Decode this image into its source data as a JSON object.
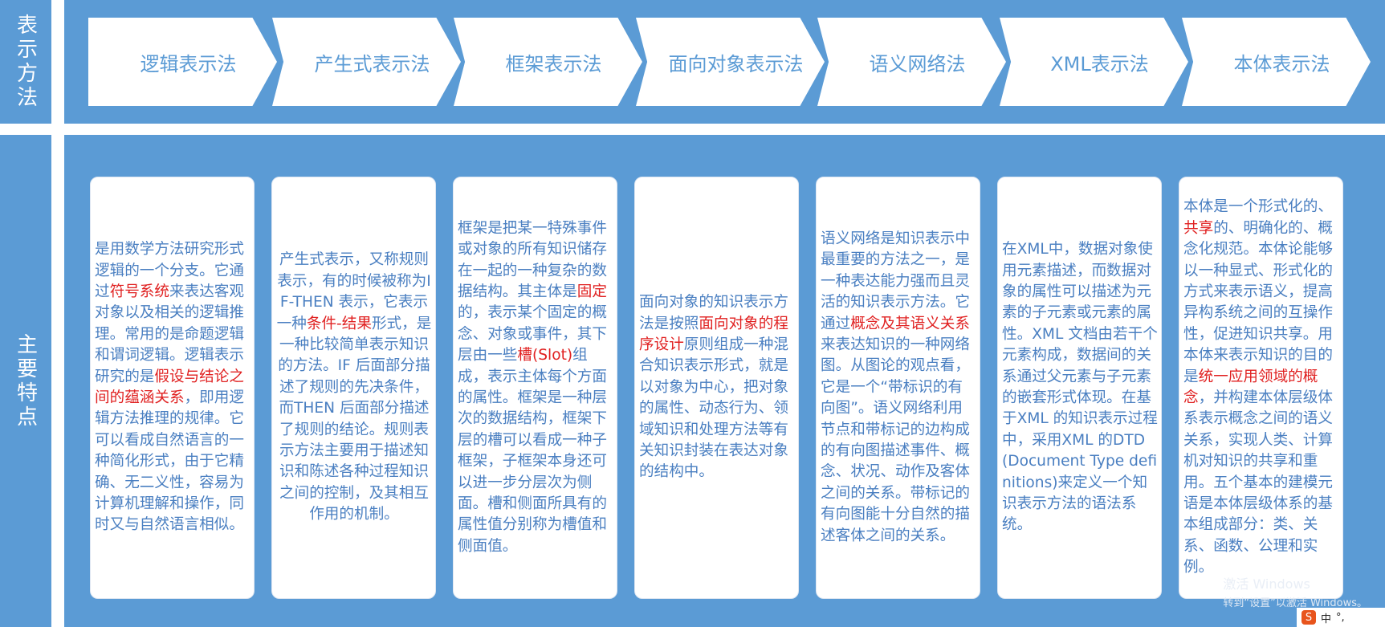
{
  "side_labels": {
    "top": "表示方法",
    "bottom": "主要特点"
  },
  "methods": [
    "逻辑表示法",
    "产生式表示法",
    "框架表示法",
    "面向对象表示法",
    "语义网络法",
    "XML表示法",
    "本体表示法"
  ],
  "features": [
    [
      {
        "t": "是用数学方法研究形式逻辑的一个分支。它通过"
      },
      {
        "t": "符号系统",
        "hl": true
      },
      {
        "t": "来表达客观对象以及相关的逻辑推理。常用的是命题逻辑和谓词逻辑。逻辑表示研究的是"
      },
      {
        "t": "假设与结论之间的蕴涵关系",
        "hl": true
      },
      {
        "t": "，即用逻辑方法推理的规律。它可以看成自然语言的一种简化形式，由于它精确、无二义性，容易为计算机理解和操作，同时又与自然语言相似。"
      }
    ],
    [
      {
        "t": "产生式表示，又称规则表示，有的时候被称为IF-THEN 表示，它表示一种"
      },
      {
        "t": "条件-结果",
        "hl": true
      },
      {
        "t": "形式，是一种比较简单表示知识的方法。IF 后面部分描述了规则的先决条件，而THEN 后面部分描述了规则的结论。规则表示方法主要用于描述知识和陈述各种过程知识之间的控制，及其相互作用的机制。"
      }
    ],
    [
      {
        "t": "框架是把某一特殊事件或对象的所有知识储存在一起的一种复杂的数据结构。其主体是"
      },
      {
        "t": "固定",
        "hl": true
      },
      {
        "t": "的，表示某个固定的概念、对象或事件，其下层由一些"
      },
      {
        "t": "槽(Slot)",
        "hl": true
      },
      {
        "t": "组成，表示主体每个方面的属性。框架是一种层次的数据结构，框架下层的槽可以看成一种子框架，子框架本身还可以进一步分层次为侧面。槽和侧面所具有的属性值分别称为槽值和侧面值。"
      }
    ],
    [
      {
        "t": "面向对象的知识表示方法是按照"
      },
      {
        "t": "面向对象的程序设计",
        "hl": true
      },
      {
        "t": "原则组成一种混合知识表示形式，就是以对象为中心，把对象的属性、动态行为、领域知识和处理方法等有关知识封装在表达对象的结构中。"
      }
    ],
    [
      {
        "t": "语义网络是知识表示中最重要的方法之一，是一种表达能力强而且灵活的知识表示方法。它通过"
      },
      {
        "t": "概念及其语义关系",
        "hl": true
      },
      {
        "t": "来表达知识的一种网络图。从图论的观点看，它是一个“带标识的有向图”。语义网络利用节点和带标记的边构成的有向图描述事件、概念、状况、动作及客体之间的关系。带标记的有向图能十分自然的描述客体之间的关系。"
      }
    ],
    [
      {
        "t": "在XML中，数据对象使用元素描述，而数据对象的属性可以描述为元素的子元素或元素的属性。XML 文档由若干个元素构成，数据间的关系通过父元素与子元素的嵌套形式体现。在基于XML 的知识表示过程中，采用XML 的DTD(Document Type definitions)来定义一个知识表示方法的语法系统。"
      }
    ],
    [
      {
        "t": "本体是一个形式化的、"
      },
      {
        "t": "共享",
        "hl": true
      },
      {
        "t": "的、明确化的、概念化规范。本体论能够以一种显式、形式化的方式来表示语义，提高异构系统之间的互操作性，促进知识共享。用本体来表示知识的目的是"
      },
      {
        "t": "统一应用领域的概念",
        "hl": true
      },
      {
        "t": "，并构建本体层级体系表示概念之间的语义关系，实现人类、计算机对知识的共享和重用。五个基本的建模元语是本体层级体系的基本组成部分：类、关系、函数、公理和实例。"
      }
    ]
  ],
  "watermark": {
    "line1": "激活 Windows",
    "line2": "转到“设置”以激活 Windows。"
  },
  "tray": {
    "logo": "S",
    "ime": "中",
    "punct": "°,"
  }
}
